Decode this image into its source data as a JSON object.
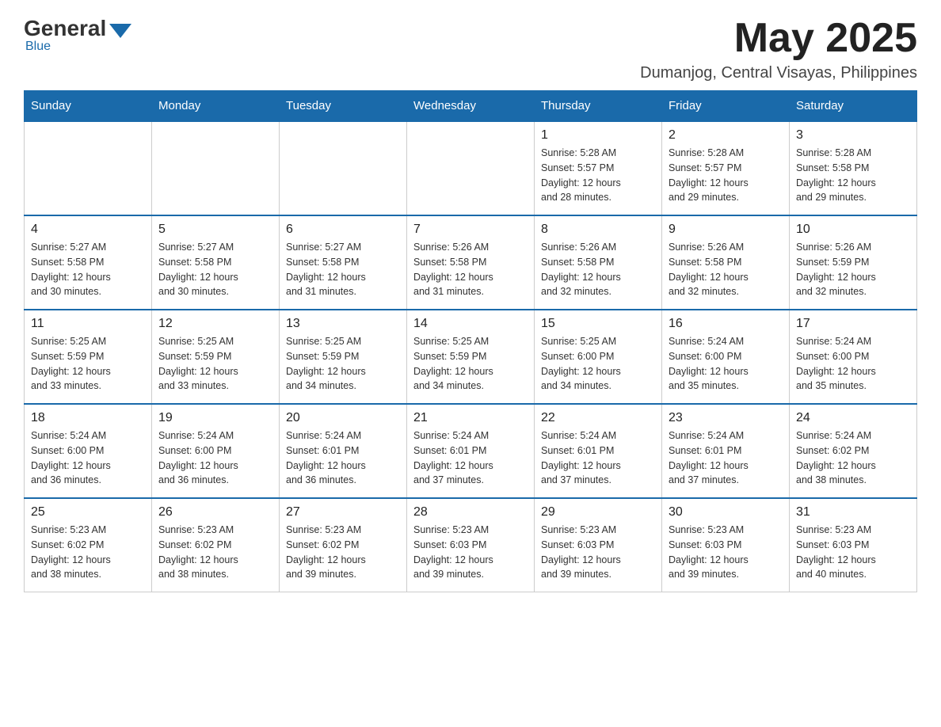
{
  "logo": {
    "general": "General",
    "blue": "Blue"
  },
  "header": {
    "month_year": "May 2025",
    "location": "Dumanjog, Central Visayas, Philippines"
  },
  "weekdays": [
    "Sunday",
    "Monday",
    "Tuesday",
    "Wednesday",
    "Thursday",
    "Friday",
    "Saturday"
  ],
  "weeks": [
    [
      {
        "day": "",
        "info": ""
      },
      {
        "day": "",
        "info": ""
      },
      {
        "day": "",
        "info": ""
      },
      {
        "day": "",
        "info": ""
      },
      {
        "day": "1",
        "info": "Sunrise: 5:28 AM\nSunset: 5:57 PM\nDaylight: 12 hours\nand 28 minutes."
      },
      {
        "day": "2",
        "info": "Sunrise: 5:28 AM\nSunset: 5:57 PM\nDaylight: 12 hours\nand 29 minutes."
      },
      {
        "day": "3",
        "info": "Sunrise: 5:28 AM\nSunset: 5:58 PM\nDaylight: 12 hours\nand 29 minutes."
      }
    ],
    [
      {
        "day": "4",
        "info": "Sunrise: 5:27 AM\nSunset: 5:58 PM\nDaylight: 12 hours\nand 30 minutes."
      },
      {
        "day": "5",
        "info": "Sunrise: 5:27 AM\nSunset: 5:58 PM\nDaylight: 12 hours\nand 30 minutes."
      },
      {
        "day": "6",
        "info": "Sunrise: 5:27 AM\nSunset: 5:58 PM\nDaylight: 12 hours\nand 31 minutes."
      },
      {
        "day": "7",
        "info": "Sunrise: 5:26 AM\nSunset: 5:58 PM\nDaylight: 12 hours\nand 31 minutes."
      },
      {
        "day": "8",
        "info": "Sunrise: 5:26 AM\nSunset: 5:58 PM\nDaylight: 12 hours\nand 32 minutes."
      },
      {
        "day": "9",
        "info": "Sunrise: 5:26 AM\nSunset: 5:58 PM\nDaylight: 12 hours\nand 32 minutes."
      },
      {
        "day": "10",
        "info": "Sunrise: 5:26 AM\nSunset: 5:59 PM\nDaylight: 12 hours\nand 32 minutes."
      }
    ],
    [
      {
        "day": "11",
        "info": "Sunrise: 5:25 AM\nSunset: 5:59 PM\nDaylight: 12 hours\nand 33 minutes."
      },
      {
        "day": "12",
        "info": "Sunrise: 5:25 AM\nSunset: 5:59 PM\nDaylight: 12 hours\nand 33 minutes."
      },
      {
        "day": "13",
        "info": "Sunrise: 5:25 AM\nSunset: 5:59 PM\nDaylight: 12 hours\nand 34 minutes."
      },
      {
        "day": "14",
        "info": "Sunrise: 5:25 AM\nSunset: 5:59 PM\nDaylight: 12 hours\nand 34 minutes."
      },
      {
        "day": "15",
        "info": "Sunrise: 5:25 AM\nSunset: 6:00 PM\nDaylight: 12 hours\nand 34 minutes."
      },
      {
        "day": "16",
        "info": "Sunrise: 5:24 AM\nSunset: 6:00 PM\nDaylight: 12 hours\nand 35 minutes."
      },
      {
        "day": "17",
        "info": "Sunrise: 5:24 AM\nSunset: 6:00 PM\nDaylight: 12 hours\nand 35 minutes."
      }
    ],
    [
      {
        "day": "18",
        "info": "Sunrise: 5:24 AM\nSunset: 6:00 PM\nDaylight: 12 hours\nand 36 minutes."
      },
      {
        "day": "19",
        "info": "Sunrise: 5:24 AM\nSunset: 6:00 PM\nDaylight: 12 hours\nand 36 minutes."
      },
      {
        "day": "20",
        "info": "Sunrise: 5:24 AM\nSunset: 6:01 PM\nDaylight: 12 hours\nand 36 minutes."
      },
      {
        "day": "21",
        "info": "Sunrise: 5:24 AM\nSunset: 6:01 PM\nDaylight: 12 hours\nand 37 minutes."
      },
      {
        "day": "22",
        "info": "Sunrise: 5:24 AM\nSunset: 6:01 PM\nDaylight: 12 hours\nand 37 minutes."
      },
      {
        "day": "23",
        "info": "Sunrise: 5:24 AM\nSunset: 6:01 PM\nDaylight: 12 hours\nand 37 minutes."
      },
      {
        "day": "24",
        "info": "Sunrise: 5:24 AM\nSunset: 6:02 PM\nDaylight: 12 hours\nand 38 minutes."
      }
    ],
    [
      {
        "day": "25",
        "info": "Sunrise: 5:23 AM\nSunset: 6:02 PM\nDaylight: 12 hours\nand 38 minutes."
      },
      {
        "day": "26",
        "info": "Sunrise: 5:23 AM\nSunset: 6:02 PM\nDaylight: 12 hours\nand 38 minutes."
      },
      {
        "day": "27",
        "info": "Sunrise: 5:23 AM\nSunset: 6:02 PM\nDaylight: 12 hours\nand 39 minutes."
      },
      {
        "day": "28",
        "info": "Sunrise: 5:23 AM\nSunset: 6:03 PM\nDaylight: 12 hours\nand 39 minutes."
      },
      {
        "day": "29",
        "info": "Sunrise: 5:23 AM\nSunset: 6:03 PM\nDaylight: 12 hours\nand 39 minutes."
      },
      {
        "day": "30",
        "info": "Sunrise: 5:23 AM\nSunset: 6:03 PM\nDaylight: 12 hours\nand 39 minutes."
      },
      {
        "day": "31",
        "info": "Sunrise: 5:23 AM\nSunset: 6:03 PM\nDaylight: 12 hours\nand 40 minutes."
      }
    ]
  ]
}
